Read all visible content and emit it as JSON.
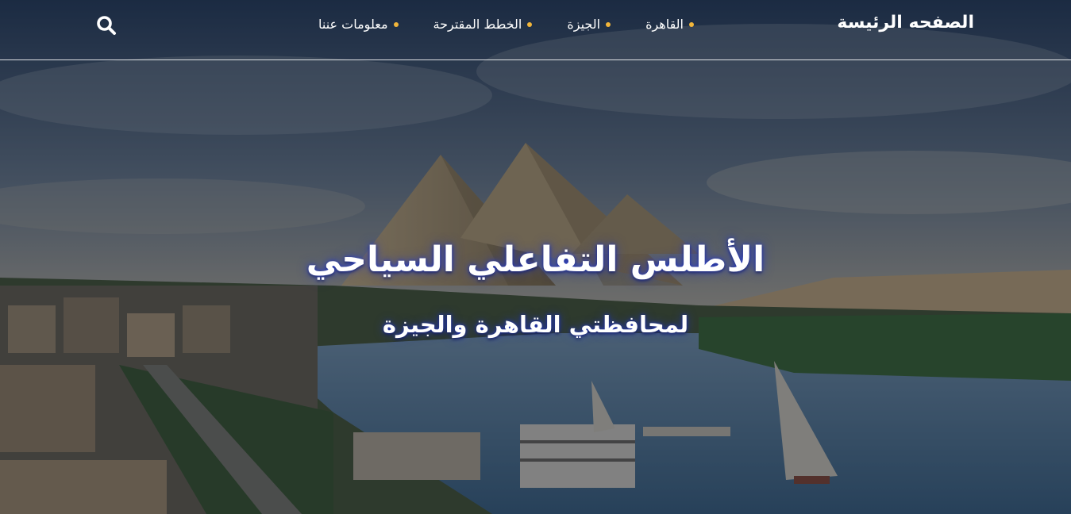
{
  "navbar": {
    "brand": "الصفحه الرئيسة",
    "items": [
      {
        "label": "القاهرة"
      },
      {
        "label": "الجيزة"
      },
      {
        "label": "الخطط المقترحة"
      },
      {
        "label": "معلومات عننا"
      }
    ],
    "search_icon": "search-icon",
    "accent_color": "#f2b63a",
    "text_color": "#ffffff"
  },
  "hero": {
    "title": "الأطلس التفاعلي السياحي",
    "subtitle": "لمحافظتي القاهرة والجيزة",
    "background": "Giza pyramids above the Nile with feluccas and riverside city",
    "glow_color": "#283cc8"
  }
}
